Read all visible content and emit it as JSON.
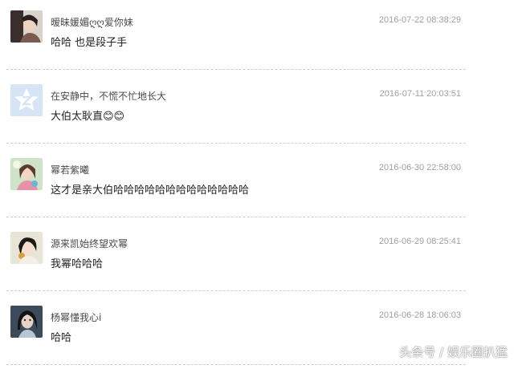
{
  "comments": [
    {
      "username": "暧昧媛媚ღღ爱你妹",
      "time": "2016-07-22 08:38:29",
      "content": "哈哈 也是段子手",
      "avatar_icon": "user-photo-avatar"
    },
    {
      "username": "在安静中，不慌不忙地长大",
      "time": "2016-07-11 20:03:51",
      "content": "大伯太耿直😊😊",
      "avatar_icon": "default-avatar-icon"
    },
    {
      "username": "幂若紫曦",
      "time": "2016-06-30 22:58:00",
      "content": "这才是亲大伯哈哈哈哈哈哈哈哈哈哈哈哈哈",
      "avatar_icon": "user-photo-avatar"
    },
    {
      "username": "源来凯始终望欢幂",
      "time": "2016-06-29 08:25:41",
      "content": "我幂哈哈哈",
      "avatar_icon": "user-photo-avatar"
    },
    {
      "username": "杨幂懂我心i",
      "time": "2016-06-28 18:06:03",
      "content": "哈哈",
      "avatar_icon": "user-photo-avatar"
    }
  ],
  "watermark": "头条号 / 娱乐圈扒猛",
  "colors": {
    "divider": "#cfcfcf",
    "time": "#a0a0a0",
    "username": "#4a4a4a",
    "default_avatar_bg": "#d6e4f5"
  }
}
